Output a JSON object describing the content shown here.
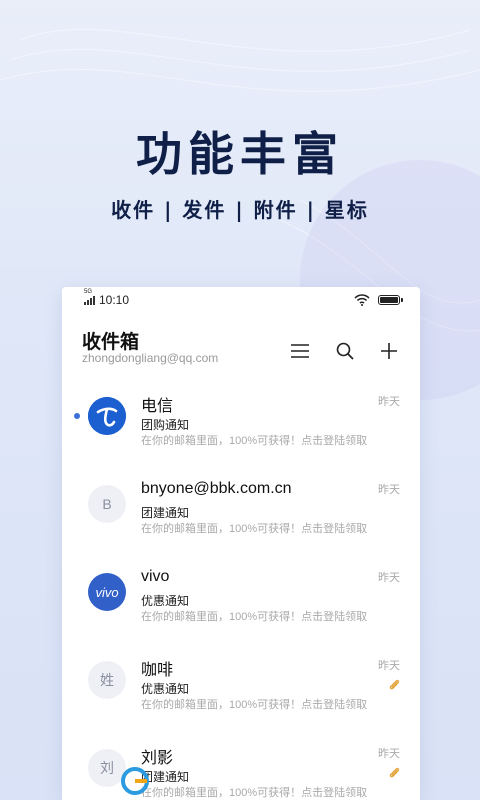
{
  "promo": {
    "title": "功能丰富",
    "subtitle": "收件 | 发件 | 附件 | 星标"
  },
  "status_bar": {
    "network": "5G",
    "time": "10:10"
  },
  "header": {
    "title": "收件箱",
    "account": "zhongdongliang@qq.com",
    "icons": [
      "menu-icon",
      "search-icon",
      "add-icon"
    ]
  },
  "mails": [
    {
      "sender": "电信",
      "subject": "团购通知",
      "preview": "在你的邮箱里面，100%可获得！点击登陆领取",
      "time": "昨天",
      "unread": true,
      "avatar": "telecom-logo",
      "attachment": false
    },
    {
      "sender": "bnyone@bbk.com.cn",
      "subject": "团建通知",
      "preview": "在你的邮箱里面，100%可获得！点击登陆领取",
      "time": "昨天",
      "unread": false,
      "avatar_letter": "B",
      "attachment": false
    },
    {
      "sender": "vivo",
      "subject": "优惠通知",
      "preview": "在你的邮箱里面，100%可获得！点击登陆领取",
      "time": "昨天",
      "unread": false,
      "avatar": "vivo-logo",
      "avatar_text": "vivo",
      "attachment": false
    },
    {
      "sender": "咖啡",
      "subject": "优惠通知",
      "preview": "在你的邮箱里面，100%可获得！点击登陆领取",
      "time": "昨天",
      "unread": false,
      "avatar_letter": "姓",
      "attachment": true
    },
    {
      "sender": "刘影",
      "subject": "团建通知",
      "preview": "在你的邮箱里面，100%可获得！点击登陆领取",
      "time": "昨天",
      "unread": false,
      "avatar_letter": "刘",
      "attachment": true
    }
  ],
  "colors": {
    "accent": "#3b6fd8",
    "title_text": "#0f1f47",
    "attachment": "#e5a43a",
    "telecom_blue": "#1b5fd0",
    "vivo_blue": "#3160c8"
  }
}
